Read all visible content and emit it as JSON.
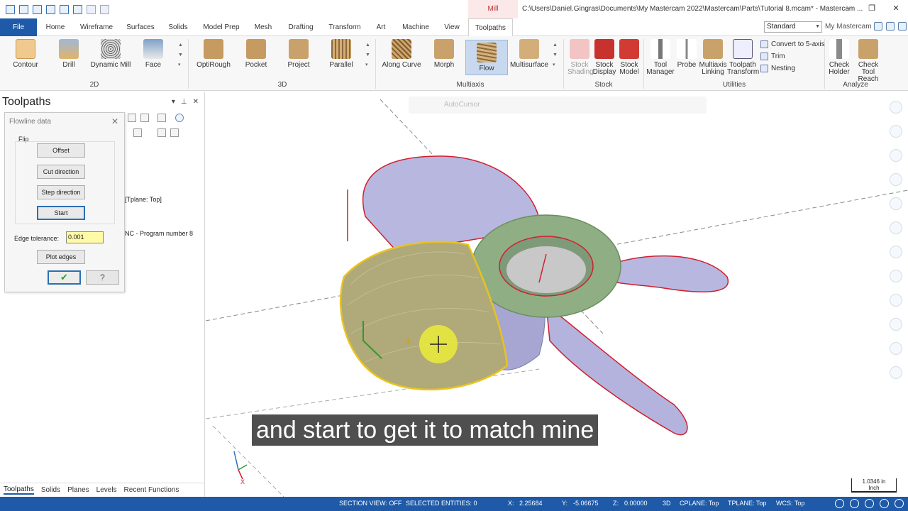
{
  "titlebar": {
    "context_tab": "Mill",
    "window_title": "C:\\Users\\Daniel.Gingras\\Documents\\My Mastercam 2022\\Mastercam\\Parts\\Tutorial 8.mcam* - Mastercam ...",
    "controls": [
      "–",
      "❐",
      "✕"
    ]
  },
  "tabs": {
    "file": "File",
    "items": [
      "Home",
      "Wireframe",
      "Surfaces",
      "Solids",
      "Model Prep",
      "Mesh",
      "Drafting",
      "Transform",
      "Art",
      "Machine",
      "View",
      "Toolpaths"
    ],
    "active": "Toolpaths",
    "workspace": "Standard",
    "my_mastercam": "My Mastercam"
  },
  "ribbon": {
    "groups": {
      "g2d": "2D",
      "g3d": "3D",
      "multiaxis": "Multiaxis",
      "stock": "Stock",
      "utilities": "Utilities",
      "analyze": "Analyze"
    },
    "buttons": {
      "contour": "Contour",
      "drill": "Drill",
      "dynamic_mill": "Dynamic Mill",
      "face": "Face",
      "optirough": "OptiRough",
      "pocket": "Pocket",
      "project": "Project",
      "parallel": "Parallel",
      "along_curve": "Along Curve",
      "morph": "Morph",
      "flow": "Flow",
      "multisurface": "Multisurface",
      "stock_shading_1": "Stock",
      "stock_shading_2": "Shading",
      "stock_display_1": "Stock",
      "stock_display_2": "Display",
      "stock_model_1": "Stock",
      "stock_model_2": "Model",
      "tool_manager_1": "Tool",
      "tool_manager_2": "Manager",
      "probe": "Probe",
      "multiaxis_linking_1": "Multiaxis",
      "multiaxis_linking_2": "Linking",
      "toolpath_transform_1": "Toolpath",
      "toolpath_transform_2": "Transform",
      "convert_5axis": "Convert to 5-axis",
      "trim": "Trim",
      "nesting": "Nesting",
      "check_holder_1": "Check",
      "check_holder_2": "Holder",
      "check_tool_reach_1": "Check",
      "check_tool_reach_2": "Tool Reach"
    }
  },
  "toolpaths_panel": {
    "title": "Toolpaths",
    "line1": "[Tplane: Top]",
    "line2": "NC - Program number 8",
    "bottom_tabs": [
      "Toolpaths",
      "Solids",
      "Planes",
      "Levels",
      "Recent Functions"
    ]
  },
  "flowline_dialog": {
    "title": "Flowline data",
    "flip_label": "Flip",
    "offset": "Offset",
    "cut_direction": "Cut direction",
    "step_direction": "Step direction",
    "start": "Start",
    "edge_tolerance_label": "Edge tolerance:",
    "edge_tolerance_value": "0.001",
    "plot_edges": "Plot edges",
    "ok_icon": "checkmark-icon",
    "help_icon": "question-icon"
  },
  "viewport": {
    "autocursor": "AutoCursor",
    "caption": "and start to get it to match mine",
    "scale_value": "1.0346 in",
    "scale_unit": "Inch",
    "axis_label_x": "X"
  },
  "statusbar": {
    "section_view": "SECTION VIEW: OFF",
    "selected": "SELECTED ENTITIES: 0",
    "x_label": "X:",
    "x_value": "2.25684",
    "y_label": "Y:",
    "y_value": "-5.06675",
    "z_label": "Z:",
    "z_value": "0.00000",
    "mode": "3D",
    "cplane": "CPLANE: Top",
    "tplane": "TPLANE: Top",
    "wcs": "WCS: Top"
  },
  "colors": {
    "accent": "#1e5aa8",
    "edge_red": "#d01f2f",
    "surface": "#b3b3dd",
    "hub_green": "#8fae84",
    "toolpath_yellow": "#e8c320"
  }
}
